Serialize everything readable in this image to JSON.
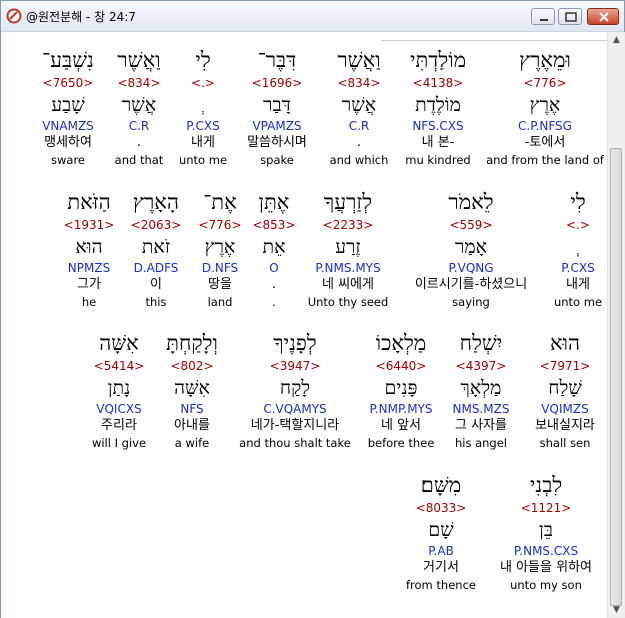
{
  "window": {
    "title": "@원전분해 - 창 24:7",
    "buttons": [
      "minimize",
      "maximize",
      "close"
    ]
  },
  "colors": {
    "strong": "#a00000",
    "morph": "#1a2ec8"
  },
  "rows": [
    {
      "words": [
        {
          "heb": "וּמֵאֶרֶץ",
          "strong": "<776>",
          "lex": "אֶרֶץ",
          "morph": "C.P.NFSG",
          "kor": "-토에서",
          "eng": "and from the land of"
        },
        {
          "heb": "מוֹלַדְתִּי",
          "strong": "<4138>",
          "lex": "מוֹלֶדֶת",
          "morph": "NFS.CXS",
          "kor": "내 본-",
          "eng": "mu kindred"
        },
        {
          "heb": "וַאֲשֶׁר",
          "strong": "<834>",
          "lex": "אֲשֶׁר",
          "morph": "C.R",
          "kor": ".",
          "eng": "and which"
        },
        {
          "heb": "דִּבֶּר־",
          "strong": "<1696>",
          "lex": "דָּבַר",
          "morph": "VPAMZS",
          "kor": "말씀하시며",
          "eng": "spake"
        },
        {
          "heb": "לִי",
          "strong": "<.>",
          "lex": "ְ",
          "morph": "P.CXS",
          "kor": "내게",
          "eng": "unto me"
        },
        {
          "heb": "וַאֲשֶׁר",
          "strong": "<834>",
          "lex": "אֲשֶׁר",
          "morph": "C.R",
          "kor": ".",
          "eng": "and that"
        },
        {
          "heb": "נִשְׁבַּע־",
          "strong": "<7650>",
          "lex": "שָׁבַע",
          "morph": "VNAMZS",
          "kor": "맹세하여",
          "eng": "sware"
        }
      ]
    },
    {
      "words": [
        {
          "heb": "לִי",
          "strong": "<.>",
          "lex": "ְ",
          "morph": "P.CXS",
          "kor": "내게",
          "eng": "unto me"
        },
        {
          "heb": "לֵאמֹר",
          "strong": "<559>",
          "lex": "אָמַר",
          "morph": "P.VQNG",
          "kor": "이르시기를-하셨으니",
          "eng": "saying"
        },
        {
          "heb": "לְזַרְעֲךָ",
          "strong": "<2233>",
          "lex": "זֶרַע",
          "morph": "P.NMS.MYS",
          "kor": "네 씨에게",
          "eng": "Unto thy seed"
        },
        {
          "heb": "אֶתֵּן",
          "strong": "<853>",
          "lex": "אֵת",
          "morph": "O",
          "kor": ".",
          "eng": "."
        },
        {
          "heb": "אֶת־",
          "strong": "<776>",
          "lex": "אֶרֶץ",
          "morph": "D.NFS",
          "kor": "땅을",
          "eng": "land"
        },
        {
          "heb": "הָאָרֶץ",
          "strong": "<2063>",
          "lex": "זֹאת",
          "morph": "D.ADFS",
          "kor": "이",
          "eng": "this"
        },
        {
          "heb": "הַזֹּאת",
          "strong": "<1931>",
          "lex": "הוּא",
          "morph": "NPMZS",
          "kor": "그가",
          "eng": "he"
        }
      ]
    },
    {
      "words": [
        {
          "heb": "הוּא",
          "strong": "<7971>",
          "lex": "שָׁלַח",
          "morph": "VQIMZS",
          "kor": "보내실지라",
          "eng": "shall sen"
        },
        {
          "heb": "יִשְׁלַח",
          "strong": "<4397>",
          "lex": "מַלְאָךְ",
          "morph": "NMS.MZS",
          "kor": "그 사자를",
          "eng": "his angel"
        },
        {
          "heb": "מַלְאָכוֹ",
          "strong": "<6440>",
          "lex": "פָּנִים",
          "morph": "P.NMP.MYS",
          "kor": "네 앞서",
          "eng": "before thee"
        },
        {
          "heb": "לְפָנֶיךָ",
          "strong": "<3947>",
          "lex": "לָקַח",
          "morph": "C.VQAMYS",
          "kor": "네가-택할지니라",
          "eng": "and thou shalt take"
        },
        {
          "heb": "וְלָקַחְתָּ",
          "strong": "<802>",
          "lex": "אִשָּׁה",
          "morph": "NFS",
          "kor": "아내를",
          "eng": "a wife"
        },
        {
          "heb": "אִשָּׁה",
          "strong": "<5414>",
          "lex": "נָתַן",
          "morph": "VQICXS",
          "kor": "주리라",
          "eng": "will I give"
        }
      ]
    },
    {
      "words": [
        {
          "heb": "לִבְנִי",
          "strong": "<1121>",
          "lex": "בֵּן",
          "morph": "P.NMS.CXS",
          "kor": "내 아들을 위하여",
          "eng": "unto my son"
        },
        {
          "heb": "מִשָּׁם׃",
          "strong": "<8033>",
          "lex": "שָׁם",
          "morph": "P.AB",
          "kor": "거기서",
          "eng": "from thence"
        }
      ]
    }
  ]
}
